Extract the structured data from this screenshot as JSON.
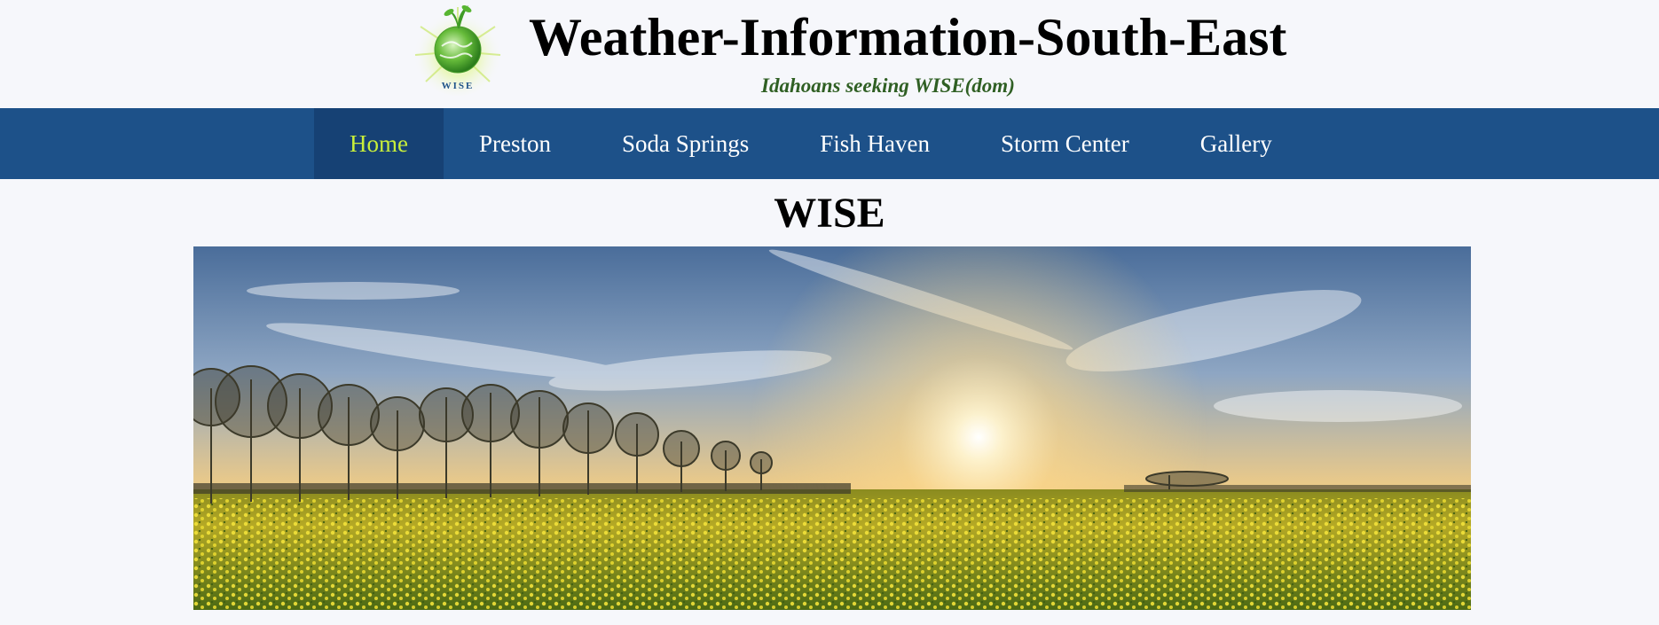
{
  "header": {
    "logo_text": "WISE",
    "title": "Weather-Information-South-East",
    "tagline": "Idahoans seeking WISE(dom)"
  },
  "nav": {
    "items": [
      {
        "label": "Home",
        "active": true
      },
      {
        "label": "Preston",
        "active": false
      },
      {
        "label": "Soda Springs",
        "active": false
      },
      {
        "label": "Fish Haven",
        "active": false
      },
      {
        "label": "Storm Center",
        "active": false
      },
      {
        "label": "Gallery",
        "active": false
      }
    ]
  },
  "main": {
    "heading": "WISE",
    "hero_image": "sunset-over-rapeseed-field"
  },
  "colors": {
    "nav_bg": "#1d5189",
    "nav_active_bg": "#164174",
    "nav_active_text": "#c8ee3a",
    "tagline": "#2f5f23",
    "page_bg": "#f6f7fb"
  }
}
